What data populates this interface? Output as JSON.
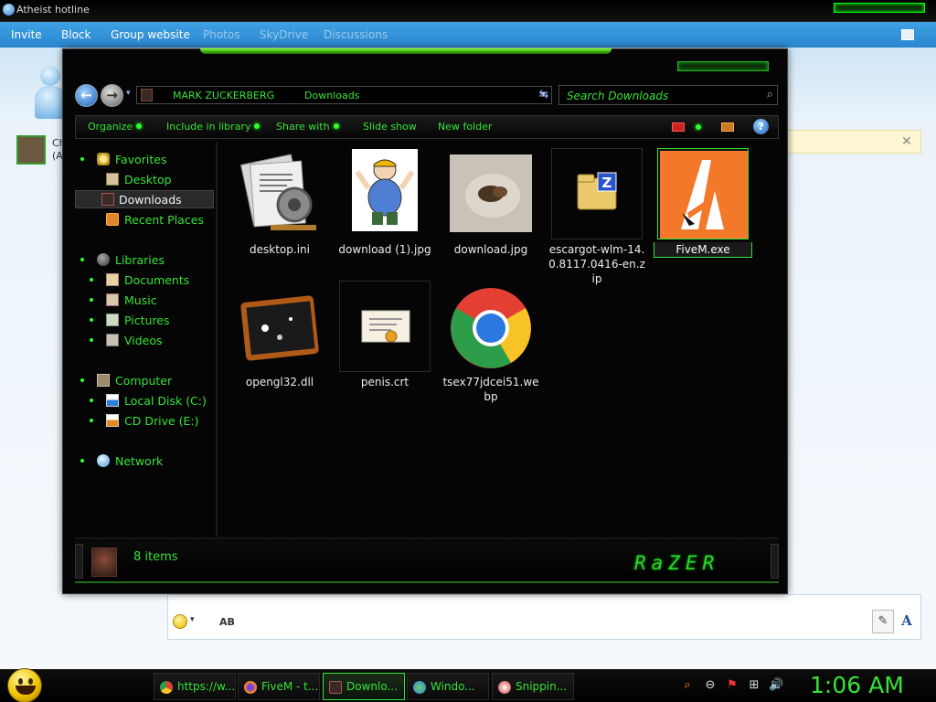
{
  "messenger": {
    "title": "Atheist hotline",
    "menu": [
      "Invite",
      "Block",
      "Group website",
      "Photos",
      "SkyDrive",
      "Discussions"
    ],
    "contact_text_line1": "Ch",
    "contact_text_line2": "(A",
    "toolbar_caret": "▾",
    "spell_label": "AB",
    "pen_icon": "✎",
    "font_label": "A"
  },
  "explorer": {
    "breadcrumb": [
      "MARK ZUCKERBERG",
      "Downloads"
    ],
    "search_placeholder": "Search Downloads",
    "nav_back": "←",
    "nav_fwd": "→",
    "nav_recent": "▾",
    "address_dd": "▾",
    "refresh": "⇆",
    "search_icon": "⌕",
    "help_label": "?",
    "commands": [
      "Organize",
      "Include in library",
      "Share with",
      "Slide show",
      "New folder"
    ],
    "nav": {
      "favorites": "Favorites",
      "desktop": "Desktop",
      "downloads": "Downloads",
      "recent": "Recent Places",
      "libraries": "Libraries",
      "documents": "Documents",
      "music": "Music",
      "pictures": "Pictures",
      "videos": "Videos",
      "computer": "Computer",
      "local_disk": "Local Disk (C:)",
      "cd_drive": "CD Drive (E:)",
      "network": "Network"
    },
    "files": [
      {
        "name": "desktop.ini",
        "icon": "settings-file-icon"
      },
      {
        "name": "download (1).jpg",
        "icon": "image-thumbnail-cartoon"
      },
      {
        "name": "download.jpg",
        "icon": "image-thumbnail-photo"
      },
      {
        "name": "escargot-wlm-14.0.8117.0416-en.zip",
        "icon": "zip-folder-icon"
      },
      {
        "name": "FiveM.exe",
        "icon": "fivem-app-icon"
      },
      {
        "name": "opengl32.dll",
        "icon": "dll-file-icon"
      },
      {
        "name": "penis.crt",
        "icon": "certificate-icon"
      },
      {
        "name": "tsex77jdcei51.webp",
        "icon": "chrome-icon"
      }
    ],
    "status_count": "8 items",
    "brand": "RaZER"
  },
  "taskbar": {
    "tasks": [
      "https://w...",
      "FiveM - t...",
      "Downlo...",
      "Windo...",
      "Snippin..."
    ],
    "tray": [
      "⌕",
      "⊖",
      "⚑",
      "⊞",
      "🔊"
    ],
    "clock": "1:06 AM"
  },
  "colors": {
    "accent_green": "#36e336",
    "msn_blue": "#2a86cf"
  }
}
